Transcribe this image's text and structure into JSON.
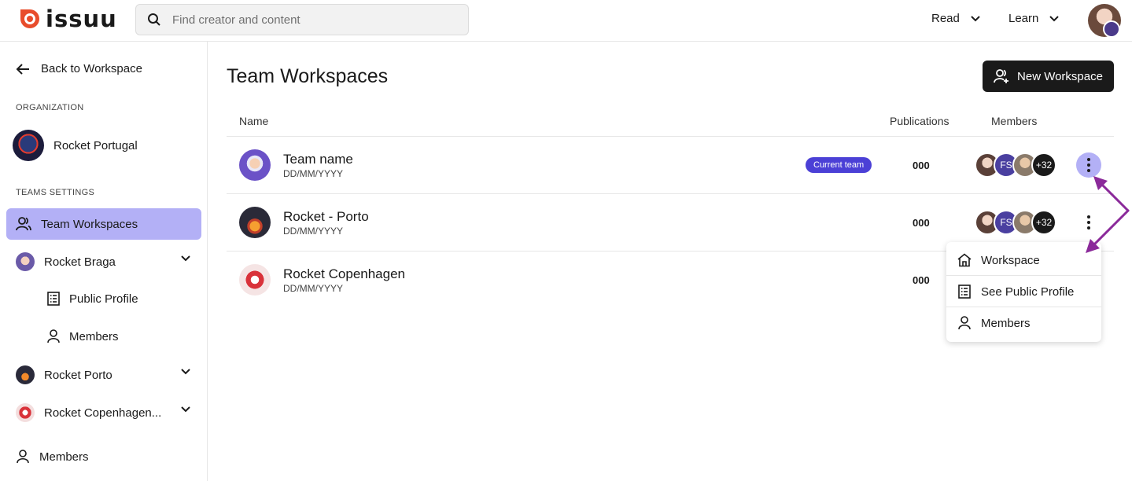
{
  "brand": {
    "name": "issuu",
    "accent": "#e84d2c"
  },
  "search": {
    "placeholder": "Find creator and content"
  },
  "topnav": {
    "read_label": "Read",
    "learn_label": "Learn"
  },
  "sidebar": {
    "back_label": "Back to Workspace",
    "org_section_label": "ORGANIZATION",
    "org_name": "Rocket Portugal",
    "teams_section_label": "TEAMS SETTINGS",
    "items": [
      {
        "label": "Team Workspaces"
      },
      {
        "label": "Rocket Braga"
      },
      {
        "label": "Public Profile"
      },
      {
        "label": "Members"
      },
      {
        "label": "Rocket Porto"
      },
      {
        "label": "Rocket Copenhagen..."
      },
      {
        "label": "Members"
      }
    ]
  },
  "main": {
    "title": "Team Workspaces",
    "new_button_label": "New Workspace",
    "columns": {
      "name": "Name",
      "publications": "Publications",
      "members": "Members"
    },
    "rows": [
      {
        "name": "Team name",
        "date": "DD/MM/YYYY",
        "badge": "Current team",
        "publications": "000",
        "member_initials": "FS",
        "more_count": "+32"
      },
      {
        "name": "Rocket - Porto",
        "date": "DD/MM/YYYY",
        "publications": "000",
        "member_initials": "FS",
        "more_count": "+32"
      },
      {
        "name": "Rocket Copenhagen",
        "date": "DD/MM/YYYY",
        "publications": "000"
      }
    ]
  },
  "context_menu": {
    "items": [
      {
        "label": "Workspace",
        "icon": "home-icon"
      },
      {
        "label": "See Public Profile",
        "icon": "list-icon"
      },
      {
        "label": "Members",
        "icon": "person-icon"
      }
    ]
  },
  "colors": {
    "active_bg": "#b3b0f6",
    "badge_bg": "#4b40d6",
    "annotation_arrow": "#8b2a9a"
  }
}
